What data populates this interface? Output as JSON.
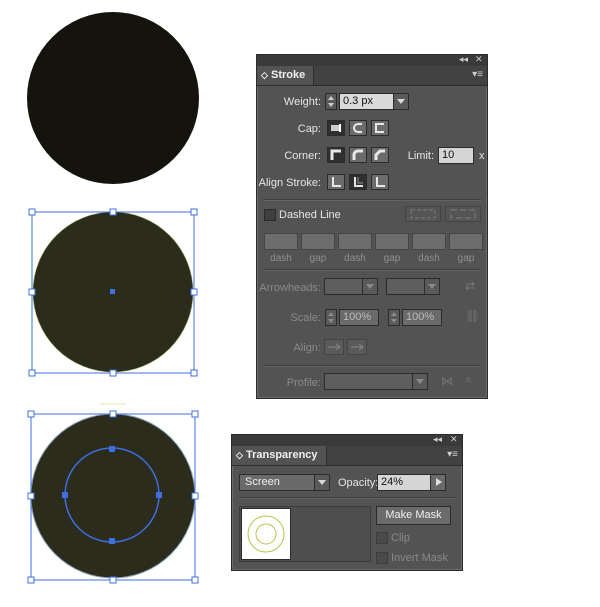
{
  "stroke_panel": {
    "title": "Stroke",
    "weight_label": "Weight:",
    "weight_value": "0.3 px",
    "cap_label": "Cap:",
    "corner_label": "Corner:",
    "limit_label": "Limit:",
    "limit_value": "10",
    "limit_unit": "x",
    "align_label": "Align Stroke:",
    "dashed_label": "Dashed Line",
    "dash_labels": [
      "dash",
      "gap",
      "dash",
      "gap",
      "dash",
      "gap"
    ],
    "arrowheads_label": "Arrowheads:",
    "scale_label": "Scale:",
    "scale_start": "100%",
    "scale_end": "100%",
    "align_arrow_label": "Align:",
    "profile_label": "Profile:"
  },
  "transparency_panel": {
    "title": "Transparency",
    "blend_mode": "Screen",
    "opacity_label": "Opacity:",
    "opacity_value": "24%",
    "make_mask_label": "Make Mask",
    "clip_label": "Clip",
    "invert_mask_label": "Invert Mask"
  },
  "panel_controls": {
    "collapse": "◂◂",
    "close": "✕",
    "menu": "▾≡",
    "tab_toggle": "◇"
  },
  "colors": {
    "circle_black": "#15130e",
    "circle_olive": "#2b2c1c",
    "selection_blue": "#3d6fe0",
    "thumb_ring": "#b9c24a",
    "panel_bg": "#535353"
  }
}
